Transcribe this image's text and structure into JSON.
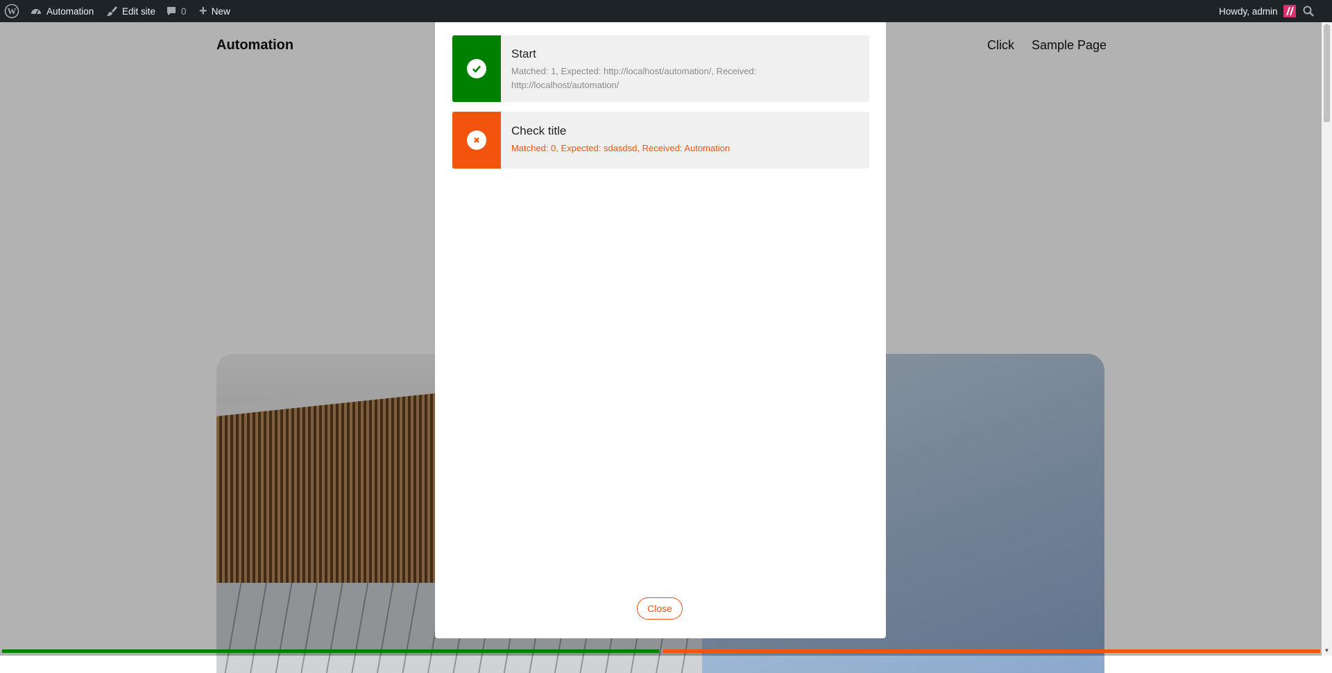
{
  "admin_bar": {
    "site_name": "Automation",
    "edit_site": "Edit site",
    "comments_count": "0",
    "new_label": "New",
    "greeting": "Howdy, admin"
  },
  "site": {
    "title": "Automation",
    "nav": [
      "Click",
      "Sample Page"
    ]
  },
  "modal": {
    "results": [
      {
        "title": "Start",
        "detail": "Matched: 1, Expected: http://localhost/automation/, Received: http://localhost/automation/",
        "status": "pass",
        "icon": "check-icon",
        "color": "#008000"
      },
      {
        "title": "Check title",
        "detail": "Matched: 0, Expected: sdasdsd, Received: Automation",
        "status": "fail",
        "icon": "x-icon",
        "color": "#f2540d"
      }
    ],
    "close_label": "Close"
  },
  "progress": {
    "passed_fraction": 0.5,
    "failed_fraction": 0.5,
    "pass_color": "#008000",
    "fail_color": "#f2540d"
  }
}
